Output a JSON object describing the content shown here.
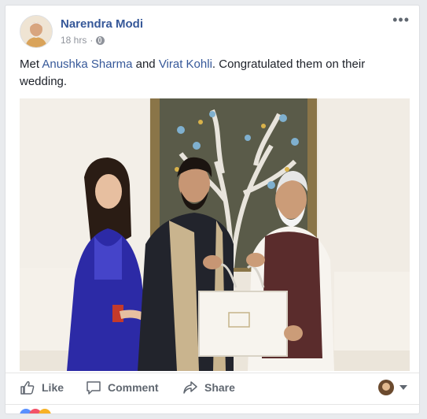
{
  "post": {
    "author": "Narendra Modi",
    "time": "18 hrs",
    "privacy_icon": "globe-icon",
    "options_label": "•••",
    "text": {
      "part1": "Met ",
      "link1": "Anushka Sharma",
      "part2": " and ",
      "link2": "Virat Kohli",
      "part3": ". Congratulated them on their wedding."
    }
  },
  "actions": {
    "like": "Like",
    "comment": "Comment",
    "share": "Share"
  },
  "colors": {
    "link": "#365899",
    "text": "#1d2129",
    "muted": "#90949c"
  }
}
